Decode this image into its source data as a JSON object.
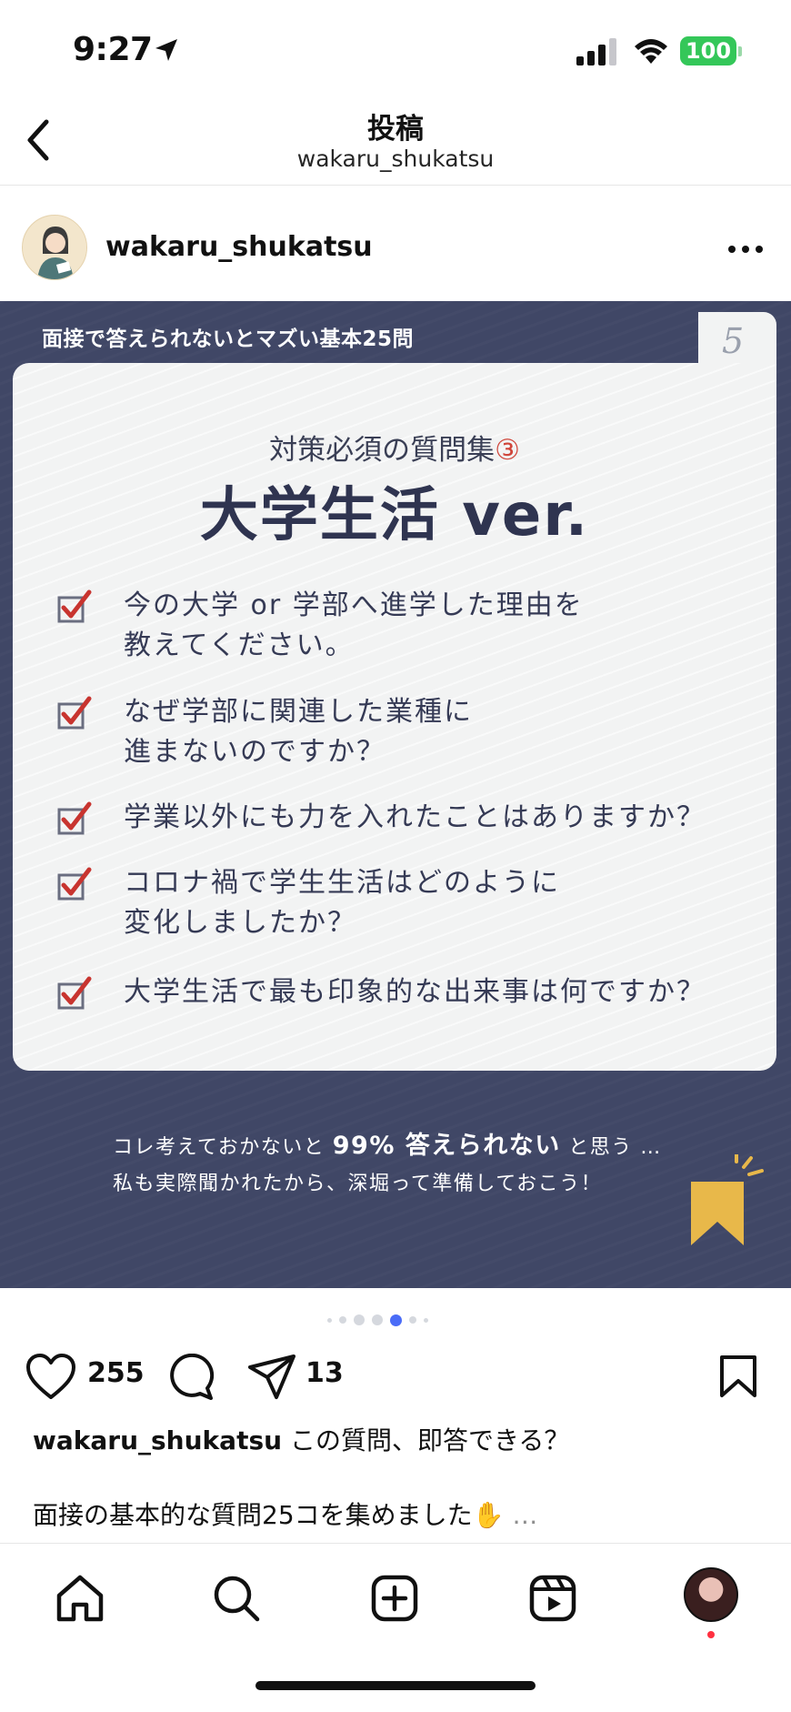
{
  "status": {
    "time": "9:27",
    "battery": "100"
  },
  "header": {
    "title": "投稿",
    "subtitle": "wakaru_shukatsu"
  },
  "post": {
    "username": "wakaru_shukatsu"
  },
  "slide": {
    "top_label": "面接で答えられないとマズい基本25問",
    "page_number": "5",
    "subtitle": "対策必須の質問集",
    "subtitle_number": "③",
    "title": "大学生活 ver.",
    "questions": [
      {
        "line1": "今の大学 or 学部へ進学した理由を",
        "line2": "教えてください。"
      },
      {
        "line1": "なぜ学部に関連した業種に",
        "line2": "進まないのですか？"
      },
      {
        "line1": "学業以外にも力を入れたことはありますか？",
        "line2": ""
      },
      {
        "line1": "コロナ禍で学生生活はどのように",
        "line2": "変化しましたか？"
      },
      {
        "line1": "大学生活で最も印象的な出来事は何ですか？",
        "line2": ""
      }
    ],
    "footer_pre": "コレ考えておかないと",
    "footer_bold": "99% 答えられない",
    "footer_post": "と思う …",
    "footer_line2": "私も実際聞かれたから、深堀って準備しておこう！"
  },
  "carousel": {
    "total": 7,
    "active": 4
  },
  "actions": {
    "likes": "255",
    "shares": "13"
  },
  "caption": {
    "username": "wakaru_shukatsu",
    "text": " この質問、即答できる？",
    "line2": "面接の基本的な質問25コを集めました",
    "emoji": "✋",
    "more": " …"
  },
  "colors": {
    "slide_bg": "#404766",
    "card_bg": "#f2f3f3",
    "check_red": "#c8342f",
    "battery_green": "#34c759",
    "accent_yellow": "#e8b84a"
  },
  "icons": [
    "location-arrow-icon",
    "signal-icon",
    "wifi-icon",
    "back-chevron-icon",
    "more-dots-icon",
    "heart-icon",
    "comment-icon",
    "share-icon",
    "bookmark-icon",
    "home-icon",
    "search-icon",
    "create-icon",
    "reels-icon"
  ]
}
